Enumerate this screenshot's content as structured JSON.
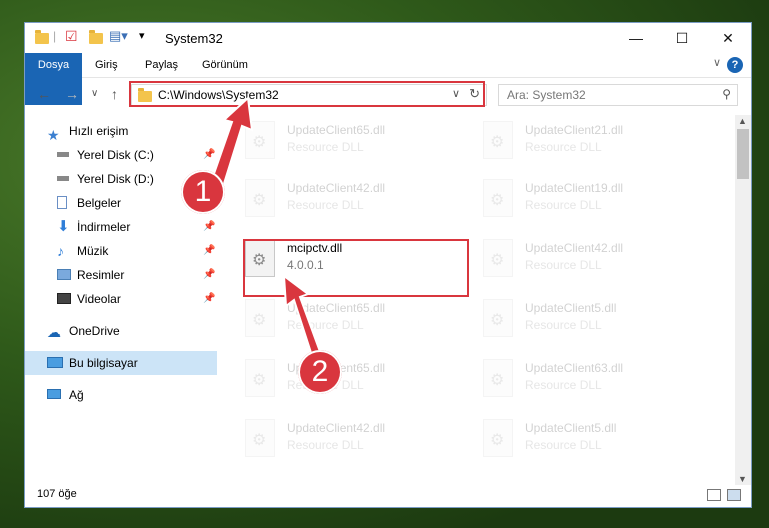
{
  "window": {
    "title": "System32",
    "controls": {
      "minimize": "—",
      "maximize": "☐",
      "close": "✕"
    }
  },
  "ribbon": {
    "tabs": [
      "Dosya",
      "Giriş",
      "Paylaş",
      "Görünüm"
    ],
    "help": "?"
  },
  "nav": {
    "address": "C:\\Windows\\System32",
    "search_placeholder": "Ara: System32"
  },
  "navpane": {
    "items": [
      {
        "label": "Hızlı erişim"
      },
      {
        "label": "Yerel Disk (C:)"
      },
      {
        "label": "Yerel Disk (D:)"
      },
      {
        "label": "Belgeler"
      },
      {
        "label": "İndirmeler"
      },
      {
        "label": "Müzik"
      },
      {
        "label": "Resimler"
      },
      {
        "label": "Videolar"
      },
      {
        "label": "OneDrive"
      },
      {
        "label": "Bu bilgisayar"
      },
      {
        "label": "Ağ"
      }
    ]
  },
  "files": {
    "left": [
      {
        "name": "UpdateClient65.dll",
        "sub": "Resource DLL"
      },
      {
        "name": "UpdateClient42.dll",
        "sub": "Resource DLL"
      },
      {
        "name": "mcipctv.dll",
        "sub": "4.0.0.1"
      },
      {
        "name": "UpdateClient65.dll",
        "sub": "Resource DLL"
      },
      {
        "name": "UpdateClient65.dll",
        "sub": "Resource DLL"
      },
      {
        "name": "UpdateClient42.dll",
        "sub": "Resource DLL"
      }
    ],
    "right": [
      {
        "name": "UpdateClient21.dll",
        "sub": "Resource DLL"
      },
      {
        "name": "UpdateClient19.dll",
        "sub": "Resource DLL"
      },
      {
        "name": "UpdateClient42.dll",
        "sub": "Resource DLL"
      },
      {
        "name": "UpdateClient5.dll",
        "sub": "Resource DLL"
      },
      {
        "name": "UpdateClient63.dll",
        "sub": "Resource DLL"
      },
      {
        "name": "UpdateClient5.dll",
        "sub": "Resource DLL"
      }
    ]
  },
  "status": {
    "count": "107 öğe"
  },
  "callouts": {
    "one": "1",
    "two": "2"
  },
  "colors": {
    "accent": "#1a65b4",
    "highlight": "#d9363e"
  }
}
